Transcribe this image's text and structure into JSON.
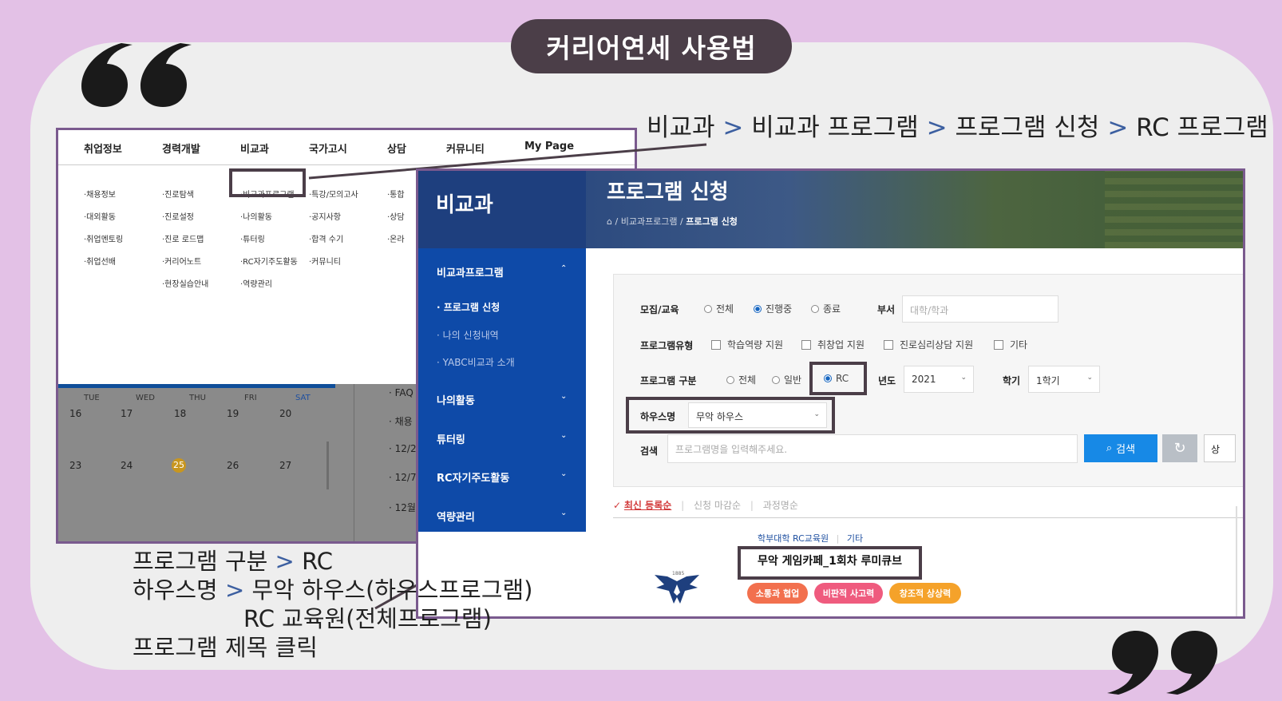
{
  "slide_title": "커리어연세 사용법",
  "breadcrumb": {
    "items": [
      "비교과",
      "비교과 프로그램",
      "프로그램 신청",
      "RC 프로그램"
    ],
    "separator": ">"
  },
  "left_screenshot": {
    "topnav": [
      "취업정보",
      "경력개발",
      "비교과",
      "국가고시",
      "상담",
      "커뮤니티",
      "My Page"
    ],
    "submenus": {
      "col1": [
        "·채용정보",
        "·대외활동",
        "·취업멘토링",
        "·취업선배"
      ],
      "col2": [
        "·진로탐색",
        "·진로설정",
        "·진로 로드맵",
        "·커리어노트",
        "·현장실습안내"
      ],
      "col3": [
        "·비교과프로그램",
        "·나의활동",
        "·튜터링",
        "·RC자기주도활동",
        "·역량관리"
      ],
      "col4": [
        "·특강/모의고사",
        "·공지사항",
        "·합격 수기",
        "·커뮤니티"
      ],
      "col5": [
        "·통합",
        "·상담",
        "·온라"
      ]
    },
    "calendar": {
      "days": [
        "TUE",
        "WED",
        "THU",
        "FRI",
        "SAT"
      ],
      "week1": [
        "16",
        "17",
        "18",
        "19",
        "20"
      ],
      "week2": [
        "23",
        "24",
        "25",
        "26",
        "27"
      ],
      "today": "25"
    },
    "side_list": [
      "· FAQ",
      "· 채용",
      "· 12/2",
      "· 12/7",
      "· 12월"
    ]
  },
  "right_screenshot": {
    "sidebar_title": "비교과",
    "page_title": "프로그램 신청",
    "crumb": {
      "home_icon": "home-icon",
      "sep": "/",
      "parent": "비교과프로그램",
      "current": "프로그램 신청"
    },
    "sidebar": {
      "group1": "비교과프로그램",
      "sub": [
        "· 프로그램 신청",
        "· 나의 신청내역",
        "· YABC비교과 소개"
      ],
      "groups": [
        "나의활동",
        "튜터링",
        "RC자기주도활동",
        "역량관리"
      ],
      "chev_up": "⌃",
      "chev_down": "⌄"
    },
    "form": {
      "recruit_label": "모집/교육",
      "recruit_options": [
        "전체",
        "진행중",
        "종료"
      ],
      "recruit_selected": "진행중",
      "dept_label": "부서",
      "dept_placeholder": "대학/학과",
      "type_label": "프로그램유형",
      "type_options": [
        "학습역량 지원",
        "취창업 지원",
        "진로심리상담 지원",
        "기타"
      ],
      "category_label": "프로그램 구분",
      "category_options": [
        "전체",
        "일반",
        "RC"
      ],
      "category_selected": "RC",
      "year_label": "년도",
      "year_value": "2021",
      "semester_label": "학기",
      "semester_value": "1학기",
      "house_label": "하우스명",
      "house_value": "무악 하우스",
      "search_label": "검색",
      "search_placeholder": "프로그램명을 입력해주세요.",
      "search_button": "검색",
      "more_button": "상"
    },
    "sort": {
      "options": [
        "최신 등록순",
        "신청 마감순",
        "과정명순"
      ],
      "active": "최신 등록순"
    },
    "result": {
      "org": "학부대학 RC교육원",
      "category": "기타",
      "title": "무악 게임카페_1회차 루미큐브",
      "tags": [
        {
          "label": "소통과 협업",
          "color": "#f2704e"
        },
        {
          "label": "비판적 사고력",
          "color": "#ef5b7e"
        },
        {
          "label": "창조적 상상력",
          "color": "#f5a22a"
        }
      ],
      "logo_year": "1885"
    }
  },
  "bottom_caption": {
    "line1": [
      "프로그램 구분",
      "RC"
    ],
    "line2": [
      "하우스명",
      "무악 하우스(하우스프로그램)"
    ],
    "line3": "RC 교육원(전체프로그램)",
    "line4": "프로그램 제목 클릭",
    "separator": ">"
  },
  "colors": {
    "background": "#e3c1e6",
    "pill": "#4b3e48",
    "sidebar_blue": "#0e4aa8",
    "search_blue": "#1789e6"
  }
}
